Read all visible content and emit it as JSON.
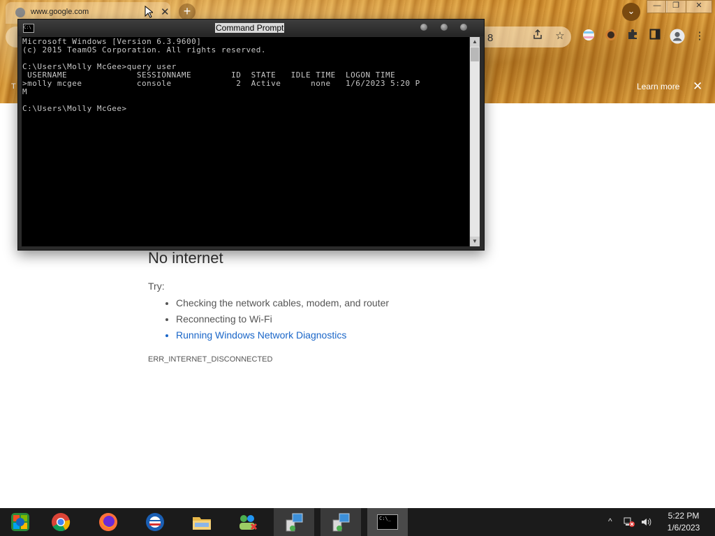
{
  "browser": {
    "tab_title": "www.google.com",
    "tab_close": "✕",
    "new_tab": "+",
    "tab_search": "⌄",
    "win_minimize": "—",
    "win_restore": "❐",
    "win_close": "✕",
    "omnibox_partial": "8",
    "info_partial": "T",
    "learn_more": "Learn more",
    "info_close": "✕"
  },
  "error_page": {
    "title": "No internet",
    "try": "Try:",
    "suggestions": [
      "Checking the network cables, modem, and router",
      "Reconnecting to Wi-Fi",
      "Running Windows Network Diagnostics"
    ],
    "code": "ERR_INTERNET_DISCONNECTED"
  },
  "cmd": {
    "title": "Command Prompt",
    "icon_text": "C:\\",
    "lines": [
      "Microsoft Windows [Version 6.3.9600]",
      "(c) 2015 TeamOS Corporation. All rights reserved.",
      "",
      "C:\\Users\\Molly McGee>query user",
      " USERNAME              SESSIONNAME        ID  STATE   IDLE TIME  LOGON TIME",
      ">molly mcgee           console             2  Active      none   1/6/2023 5:20 P",
      "M",
      "",
      "C:\\Users\\Molly McGee>"
    ]
  },
  "taskbar": {
    "time": "5:22 PM",
    "date": "1/6/2023",
    "tray_chevron": "^",
    "cmd_icon_text": "C:\\_"
  }
}
